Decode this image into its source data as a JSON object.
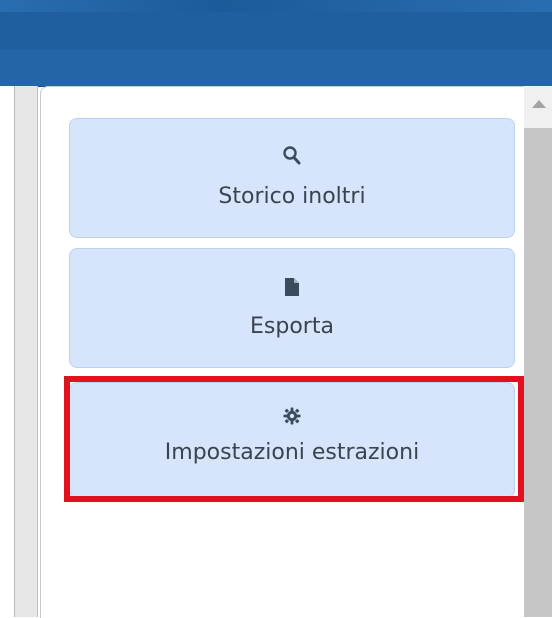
{
  "menu": {
    "items": [
      {
        "label": "Storico inoltri",
        "icon": "search-icon"
      },
      {
        "label": "Esporta",
        "icon": "file-icon"
      },
      {
        "label": "Impostazioni estrazioni",
        "icon": "gear-icon"
      }
    ]
  },
  "highlight": {
    "color": "#e3111f",
    "target": "Impostazioni estrazioni"
  },
  "colors": {
    "header": "#2366a8",
    "button_bg": "#d6e5fb",
    "button_text": "#3a4350"
  }
}
